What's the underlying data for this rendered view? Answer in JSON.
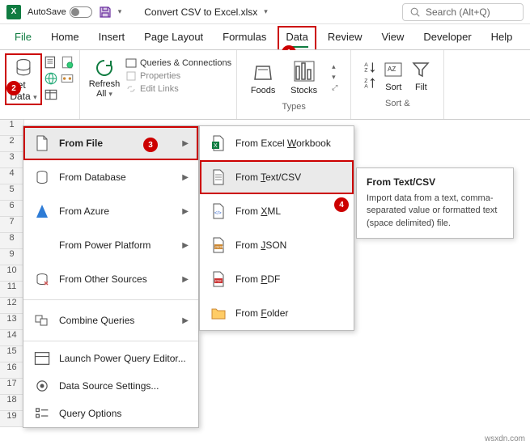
{
  "titlebar": {
    "autosave_label": "AutoSave",
    "file_name": "Convert CSV to Excel.xlsx",
    "search_placeholder": "Search (Alt+Q)"
  },
  "menubar": {
    "items": [
      "File",
      "Home",
      "Insert",
      "Page Layout",
      "Formulas",
      "Data",
      "Review",
      "View",
      "Developer",
      "Help"
    ],
    "active_index": 5
  },
  "badges": {
    "b1": "1",
    "b2": "2",
    "b3": "3",
    "b4": "4"
  },
  "ribbon": {
    "get_data_label1": "Get",
    "get_data_label2": "Data",
    "refresh_label1": "Refresh",
    "refresh_label2": "All",
    "queries_conn": "Queries & Connections",
    "properties": "Properties",
    "edit_links": "Edit Links",
    "foods": "Foods",
    "stocks": "Stocks",
    "data_types_label": "Types",
    "sort": "Sort",
    "filter": "Filt",
    "sort_filter_label": "Sort &"
  },
  "panel1": {
    "items": [
      {
        "label": "From File",
        "hl": true,
        "arrow": true
      },
      {
        "label": "From Database",
        "arrow": true
      },
      {
        "label": "From Azure",
        "arrow": true
      },
      {
        "label": "From Power Platform",
        "arrow": true
      },
      {
        "label": "From Other Sources",
        "arrow": true
      },
      {
        "label": "Combine Queries",
        "arrow": true
      }
    ],
    "footer": [
      {
        "label": "Launch Power Query Editor..."
      },
      {
        "label": "Data Source Settings..."
      },
      {
        "label": "Query Options"
      }
    ]
  },
  "panel2": {
    "items": [
      {
        "label": "From Excel Workbook"
      },
      {
        "label": "From Text/CSV",
        "hl": true
      },
      {
        "label": "From XML"
      },
      {
        "label": "From JSON"
      },
      {
        "label": "From PDF"
      },
      {
        "label": "From Folder"
      }
    ]
  },
  "tooltip": {
    "title": "From Text/CSV",
    "body": "Import data from a text, comma-separated value or formatted text (space delimited) file."
  },
  "rows": [
    "1",
    "2",
    "3",
    "4",
    "5",
    "6",
    "7",
    "8",
    "9",
    "10",
    "11",
    "12",
    "13",
    "14",
    "15",
    "16",
    "17",
    "18",
    "19"
  ],
  "watermark": "wsxdn.com"
}
